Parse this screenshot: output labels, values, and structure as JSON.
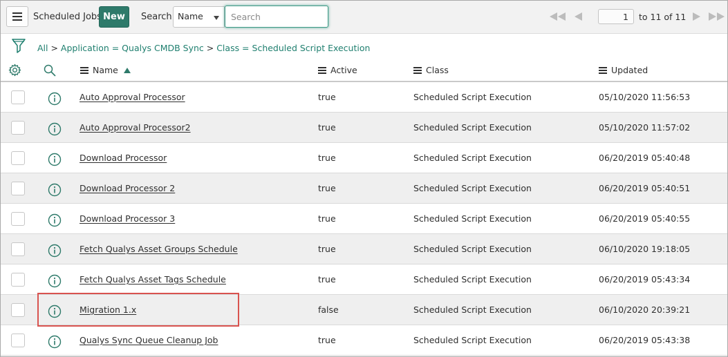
{
  "header": {
    "title": "Scheduled Jobs",
    "new_label": "New",
    "search_label": "Search",
    "search_field": "Name",
    "search_placeholder": "Search",
    "page_current": "1",
    "page_summary": "to 11 of 11"
  },
  "breadcrumb": [
    {
      "text": "All"
    },
    {
      "text": "Application = Qualys CMDB Sync"
    },
    {
      "text": "Class = Scheduled Script Execution"
    }
  ],
  "columns": {
    "name": "Name",
    "active": "Active",
    "class": "Class",
    "updated": "Updated"
  },
  "rows": [
    {
      "name": "Auto Approval Processor",
      "active": "true",
      "class": "Scheduled Script Execution",
      "updated": "05/10/2020 11:56:53"
    },
    {
      "name": "Auto Approval Processor2",
      "active": "true",
      "class": "Scheduled Script Execution",
      "updated": "05/10/2020 11:57:02"
    },
    {
      "name": "Download Processor",
      "active": "true",
      "class": "Scheduled Script Execution",
      "updated": "06/20/2019 05:40:48"
    },
    {
      "name": "Download Processor 2",
      "active": "true",
      "class": "Scheduled Script Execution",
      "updated": "06/20/2019 05:40:51"
    },
    {
      "name": "Download Processor 3",
      "active": "true",
      "class": "Scheduled Script Execution",
      "updated": "06/20/2019 05:40:55"
    },
    {
      "name": "Fetch Qualys Asset Groups Schedule",
      "active": "true",
      "class": "Scheduled Script Execution",
      "updated": "06/10/2020 19:18:05"
    },
    {
      "name": "Fetch Qualys Asset Tags Schedule",
      "active": "true",
      "class": "Scheduled Script Execution",
      "updated": "06/20/2019 05:43:34"
    },
    {
      "name": "Migration 1.x",
      "active": "false",
      "class": "Scheduled Script Execution",
      "updated": "06/10/2020 20:39:21"
    },
    {
      "name": "Qualys Sync Queue Cleanup Job",
      "active": "true",
      "class": "Scheduled Script Execution",
      "updated": "06/20/2019 05:43:38"
    }
  ],
  "colors": {
    "accent": "#2e7a6a",
    "link": "#1f7f6f",
    "highlight": "#d9534f",
    "row_alt": "#efefef"
  },
  "icons": [
    "hamburger-menu-icon",
    "first-page-icon",
    "previous-page-icon",
    "next-page-icon",
    "last-page-icon",
    "filter-icon",
    "gear-icon",
    "search-icon",
    "info-icon"
  ]
}
